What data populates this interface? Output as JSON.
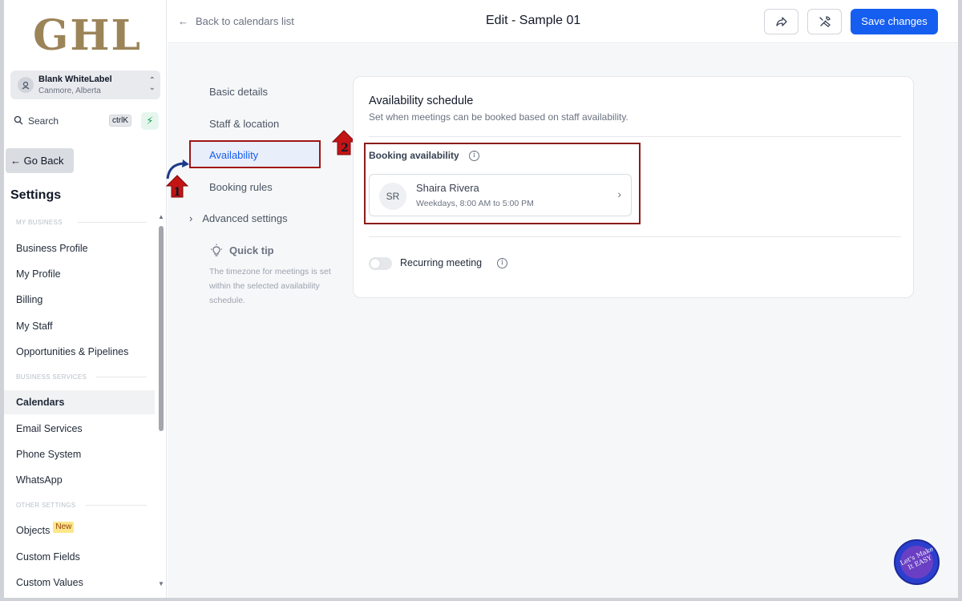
{
  "sidebar": {
    "logo": "GHL",
    "account": {
      "name": "Blank WhiteLabel",
      "location": "Canmore, Alberta"
    },
    "search": {
      "label": "Search",
      "shortcut": "ctrlK"
    },
    "go_back": "Go Back",
    "title": "Settings",
    "sections": [
      {
        "label": "MY BUSINESS"
      },
      {
        "label": "BUSINESS SERVICES"
      },
      {
        "label": "OTHER SETTINGS"
      }
    ],
    "items": [
      {
        "label": "Business Profile"
      },
      {
        "label": "My Profile"
      },
      {
        "label": "Billing"
      },
      {
        "label": "My Staff"
      },
      {
        "label": "Opportunities & Pipelines"
      },
      {
        "label": "Calendars"
      },
      {
        "label": "Email Services"
      },
      {
        "label": "Phone System"
      },
      {
        "label": "WhatsApp"
      },
      {
        "label": "Objects",
        "badge": "New"
      },
      {
        "label": "Custom Fields"
      },
      {
        "label": "Custom Values"
      }
    ],
    "active_item": "Calendars"
  },
  "topbar": {
    "back_label": "Back to calendars list",
    "title": "Edit - Sample 01",
    "save_label": "Save changes"
  },
  "subnav": {
    "items": [
      {
        "label": "Basic details"
      },
      {
        "label": "Staff & location"
      },
      {
        "label": "Availability"
      },
      {
        "label": "Booking rules"
      },
      {
        "label": "Advanced settings"
      }
    ],
    "active": "Availability",
    "quick_tip": {
      "title": "Quick tip",
      "text": "The timezone for meetings is set within the selected availability schedule."
    }
  },
  "card": {
    "title": "Availability schedule",
    "subtitle": "Set when meetings can be booked based on staff availability.",
    "booking_label": "Booking availability",
    "staff": {
      "initials": "SR",
      "name": "Shaira Rivera",
      "hours": "Weekdays, 8:00 AM to 5:00 PM"
    },
    "recurring_label": "Recurring meeting",
    "recurring_enabled": false
  },
  "annotations": {
    "marker1": "1",
    "marker2": "2"
  },
  "fab": {
    "label": "Let's Make It EASY"
  },
  "colors": {
    "accent": "#155eef",
    "annotation_red": "#a01515",
    "logo_gold": "#9c8459"
  }
}
